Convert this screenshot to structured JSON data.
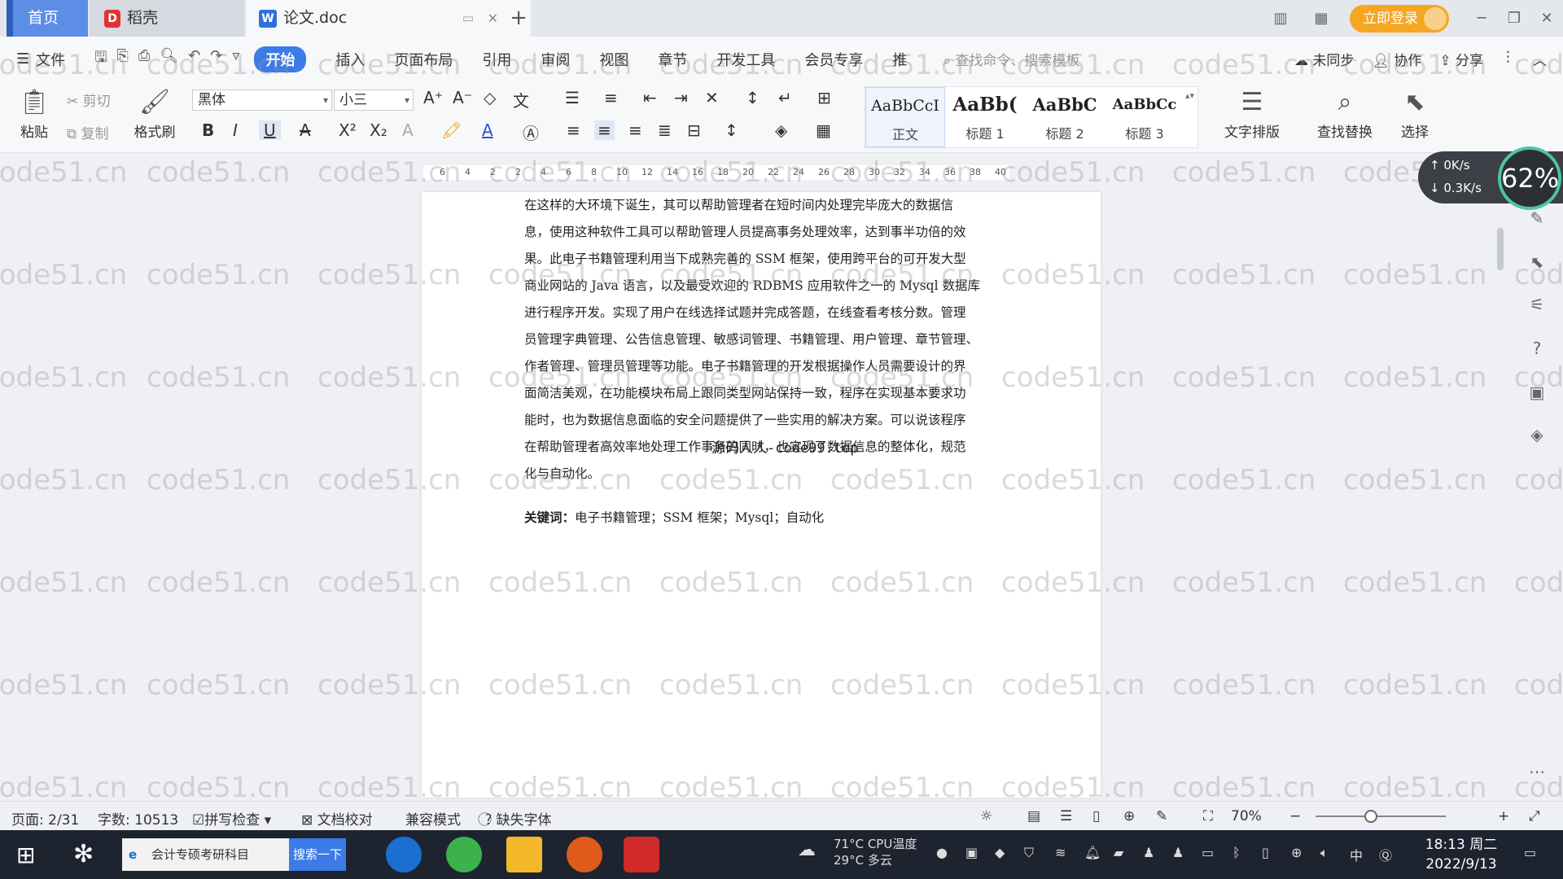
{
  "tabs": {
    "home": "首页",
    "daoke": "稻壳",
    "doc": "论文.doc",
    "login": "立即登录"
  },
  "menu": {
    "file": "文件",
    "items": [
      "开始",
      "插入",
      "页面布局",
      "引用",
      "审阅",
      "视图",
      "章节",
      "开发工具",
      "会员专享",
      "推"
    ],
    "search_cmd": "查找命令、搜索模板",
    "sync": "未同步",
    "collab": "协作",
    "share": "分享"
  },
  "ribbon": {
    "paste": "粘贴",
    "cut": "剪切",
    "copy": "复制",
    "format_painter": "格式刷",
    "font": "黑体",
    "size": "小三",
    "styles": [
      {
        "preview": "AaBbCcI",
        "name": "正文"
      },
      {
        "preview": "AaBb(",
        "name": "标题 1"
      },
      {
        "preview": "AaBbC",
        "name": "标题 2"
      },
      {
        "preview": "AaBbCc",
        "name": "标题 3"
      }
    ],
    "text_layout": "文字排版",
    "find_replace": "查找替换",
    "select": "选择"
  },
  "ruler_ticks": [
    "6",
    "4",
    "2",
    "2",
    "4",
    "6",
    "8",
    "10",
    "12",
    "14",
    "16",
    "18",
    "20",
    "22",
    "24",
    "26",
    "28",
    "30",
    "32",
    "34",
    "36",
    "38",
    "40"
  ],
  "document": {
    "lines": [
      "在这样的大环境下诞生，其可以帮助管理者在短时间内处理完毕庞大的数据信",
      "息，使用这种软件工具可以帮助管理人员提高事务处理效率，达到事半功倍的效",
      "果。此电子书籍管理利用当下成熟完善的 SSM 框架，使用跨平台的可开发大型",
      "商业网站的 Java 语言，以及最受欢迎的 RDBMS 应用软件之一的 Mysql 数据库",
      "进行程序开发。实现了用户在线选择试题并完成答题，在线查看考核分数。管理",
      "员管理字典管理、公告信息管理、敏感词管理、书籍管理、用户管理、章节管理、",
      "作者管理、管理员管理等功能。电子书籍管理的开发根据操作人员需要设计的界",
      "面简洁美观，在功能模块布局上跟同类型网站保持一致，程序在实现基本要求功",
      "能时，也为数据信息面临的安全问题提供了一些实用的解决方案。可以说该程序",
      "在帮助管理者高效率地处理工作事务的同时，也实现了数据信息的整体化，规范",
      "化与自动化。"
    ],
    "overlay": "源码人人-code99.top",
    "keywords_label": "关键词：",
    "keywords": "电子书籍管理；SSM 框架；Mysql；自动化"
  },
  "watermark": "code51.cn",
  "speed": {
    "up": "0K/s",
    "down": "0.3K/s",
    "percent": "62%"
  },
  "status": {
    "page": "页面: 2/31",
    "words": "字数: 10513",
    "spell": "拼写检查",
    "proof": "文档校对",
    "compat": "兼容模式",
    "missing_font": "缺失字体",
    "zoom": "70%"
  },
  "taskbar": {
    "search_text": "会计专硕考研科目",
    "search_btn": "搜索一下",
    "weather": "29°C 多云",
    "cpu": "71°C CPU温度",
    "ime": "中",
    "time": "18:13 周二",
    "date": "2022/9/13"
  },
  "colors": {
    "accent": "#3c7be8",
    "login": "#f5a623",
    "taskbar": "#1d2430"
  }
}
